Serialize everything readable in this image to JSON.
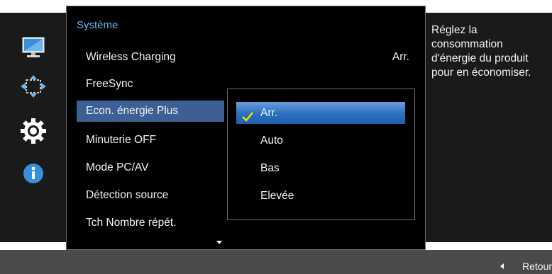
{
  "sidebar": {
    "icons": [
      {
        "name": "picture-icon"
      },
      {
        "name": "onscreen-display-icon"
      },
      {
        "name": "settings-gear-icon"
      },
      {
        "name": "information-icon"
      }
    ]
  },
  "menu": {
    "title": "Système",
    "items": [
      {
        "label": "Wireless Charging",
        "value": "Arr."
      },
      {
        "label": "FreeSync",
        "value": ""
      },
      {
        "label": "Econ. énergie Plus",
        "value": ""
      },
      {
        "label": "Minuterie OFF",
        "value": ""
      },
      {
        "label": "Mode PC/AV",
        "value": ""
      },
      {
        "label": "Détection source",
        "value": ""
      },
      {
        "label": "Tch Nombre répét.",
        "value": ""
      }
    ],
    "selected_index": 2
  },
  "submenu": {
    "options": [
      "Arr.",
      "Auto",
      "Bas",
      "Elevée"
    ],
    "selected": "Arr."
  },
  "description": "Réglez la consommation d'énergie du produit pour en économiser.",
  "footer": {
    "back_label": "Retour"
  },
  "colors": {
    "title_accent": "#6fb6e8",
    "selected_item": "#3c5f94",
    "submenu_highlight": "#2b6fc0",
    "check": "#f0e000"
  }
}
